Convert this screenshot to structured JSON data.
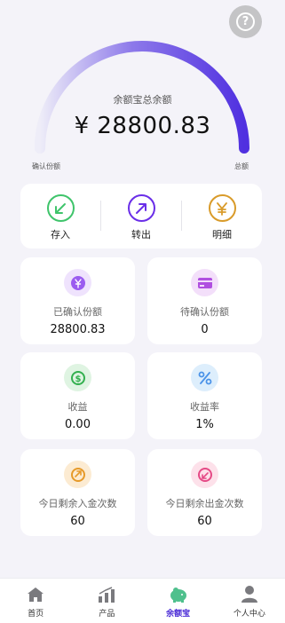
{
  "header": {
    "help_icon": "question-circle-icon"
  },
  "gauge": {
    "title": "余额宝总余额",
    "amount": "¥ 28800.83",
    "fill_fraction": 1.0,
    "left_label": "确认份额",
    "right_label": "总额",
    "colors": {
      "start": "#eeedf8",
      "end": "#5030e0"
    }
  },
  "actions": [
    {
      "label": "存入",
      "icon": "arrow-down-left-icon",
      "color": "#3fc46b"
    },
    {
      "label": "转出",
      "icon": "arrow-up-right-icon",
      "color": "#6a2ee8"
    },
    {
      "label": "明细",
      "icon": "yen-icon",
      "color": "#d99b2a"
    }
  ],
  "cards": [
    {
      "label": "已确认份额",
      "value": "28800.83",
      "icon": "yen-badge-icon",
      "color": "#9b5cf0",
      "bg": "#efe3fd"
    },
    {
      "label": "待确认份额",
      "value": "0",
      "icon": "card-icon",
      "color": "#b04fe0",
      "bg": "#f3dffa"
    },
    {
      "label": "收益",
      "value": "0.00",
      "icon": "refresh-dollar-icon",
      "color": "#33b04f",
      "bg": "#dff4e2"
    },
    {
      "label": "收益率",
      "value": "1%",
      "icon": "percent-icon",
      "color": "#4a92e8",
      "bg": "#ddeefc"
    },
    {
      "label": "今日剩余入金次数",
      "value": "60",
      "icon": "deposit-count-icon",
      "color": "#e69a2a",
      "bg": "#fcebd2"
    },
    {
      "label": "今日剩余出金次数",
      "value": "60",
      "icon": "withdraw-count-icon",
      "color": "#e54a86",
      "bg": "#fde1ea"
    }
  ],
  "nav": [
    {
      "label": "首页",
      "icon": "home-icon",
      "active": false
    },
    {
      "label": "产品",
      "icon": "bar-chart-icon",
      "active": false
    },
    {
      "label": "余额宝",
      "icon": "piggy-bank-icon",
      "active": true
    },
    {
      "label": "个人中心",
      "icon": "user-icon",
      "active": false
    }
  ]
}
